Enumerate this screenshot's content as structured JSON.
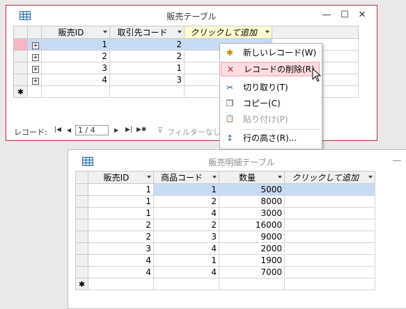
{
  "window1": {
    "title": "販売テーブル",
    "columns": [
      "販売ID",
      "取引先コード",
      "クリックして追加"
    ],
    "rows": [
      {
        "id": "1",
        "code": "2"
      },
      {
        "id": "2",
        "code": "2"
      },
      {
        "id": "3",
        "code": "1"
      },
      {
        "id": "4",
        "code": "3"
      }
    ],
    "new_row_symbol": "✱",
    "nav": {
      "label": "レコード:",
      "first": "|◀",
      "prev": "◀",
      "current": "1 / 4",
      "next": "▶",
      "last": "▶|",
      "new": "▶✱",
      "filter": "フィルターなし"
    }
  },
  "context_menu": {
    "items": [
      {
        "label": "新しいレコード(W)",
        "icon": "new-record-icon",
        "glyph": "✱",
        "state": "normal"
      },
      {
        "label": "レコードの削除(R)",
        "icon": "delete-record-icon",
        "glyph": "✕",
        "state": "highlighted"
      },
      {
        "label": "切り取り(T)",
        "icon": "scissors-icon",
        "glyph": "✂",
        "state": "normal"
      },
      {
        "label": "コピー(C)",
        "icon": "copy-icon",
        "glyph": "❐",
        "state": "normal"
      },
      {
        "label": "貼り付け(P)",
        "icon": "paste-icon",
        "glyph": "📋",
        "state": "disabled"
      },
      {
        "label": "行の高さ(R)...",
        "icon": "row-height-icon",
        "glyph": "↕",
        "state": "normal"
      }
    ]
  },
  "window2": {
    "title": "販売明細テーブル",
    "columns": [
      "販売ID",
      "商品コード",
      "数量",
      "クリックして追加"
    ],
    "rows": [
      {
        "id": "1",
        "product": "1",
        "qty": "5000"
      },
      {
        "id": "1",
        "product": "2",
        "qty": "8000"
      },
      {
        "id": "1",
        "product": "4",
        "qty": "3000"
      },
      {
        "id": "2",
        "product": "2",
        "qty": "16000"
      },
      {
        "id": "2",
        "product": "3",
        "qty": "9000"
      },
      {
        "id": "3",
        "product": "4",
        "qty": "2000"
      },
      {
        "id": "4",
        "product": "1",
        "qty": "1900"
      },
      {
        "id": "4",
        "product": "4",
        "qty": "7000"
      }
    ],
    "new_row_symbol": "✱"
  },
  "colors": {
    "accent_border": "#b2363a",
    "selection": "#c7dbf4",
    "highlight": "#fddbe0"
  }
}
